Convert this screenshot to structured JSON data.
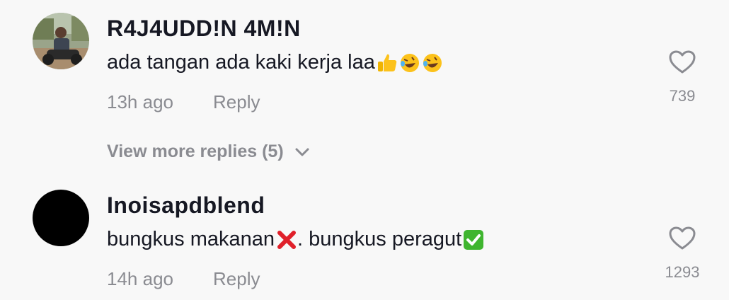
{
  "comments": [
    {
      "username": "R4J4UDD!N 4M!N",
      "text": "ada tangan ada kaki kerja laa",
      "emojis": [
        "thumbs-up-emoji",
        "rofl-emoji",
        "rofl-emoji"
      ],
      "time": "13h ago",
      "reply_label": "Reply",
      "likes": "739",
      "avatar": "photo-avatar"
    },
    {
      "username": "Inoisapdblend",
      "text_before": "bungkus makanan",
      "text_middle": ". bungkus peragut",
      "emojis": [
        "cross-mark-emoji",
        "check-mark-emoji"
      ],
      "time": "14h ago",
      "reply_label": "Reply",
      "likes": "1293",
      "avatar": "black-avatar"
    }
  ],
  "view_more_replies": "View more replies (5)",
  "colors": {
    "background": "#f8f8f8",
    "primary_text": "#161823",
    "secondary_text": "#8a8b91"
  }
}
